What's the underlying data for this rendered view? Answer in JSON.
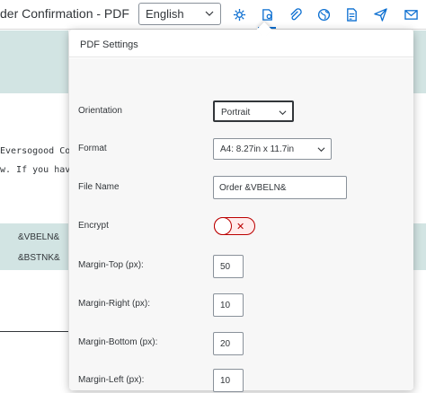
{
  "toolbar": {
    "doc_title": "der Confirmation - PDF",
    "language": "English",
    "icons": [
      "settings-icon",
      "pdf-settings-icon",
      "attachment-icon",
      "globe-icon",
      "document-icon",
      "send-icon",
      "email-icon"
    ]
  },
  "background": {
    "line1": "Eversogood Cor",
    "line2": "w. If you have a",
    "cell1": "&VBELN&",
    "cell2": "&BSTNK&"
  },
  "popover": {
    "title": "PDF Settings",
    "orientation_label": "Orientation",
    "orientation_value": "Portrait",
    "format_label": "Format",
    "format_value": "A4: 8.27in x 11.7in",
    "file_name_label": "File Name",
    "file_name_value": "Order &VBELN&",
    "encrypt_label": "Encrypt",
    "encrypt_on": false,
    "margin_top_label": "Margin-Top (px):",
    "margin_top_value": "50",
    "margin_right_label": "Margin-Right (px):",
    "margin_right_value": "10",
    "margin_bottom_label": "Margin-Bottom (px):",
    "margin_bottom_value": "20",
    "margin_left_label": "Margin-Left (px):",
    "margin_left_value": "10"
  },
  "colors": {
    "accent": "#0a6ed1",
    "teal_band": "#d2e4e3",
    "toggle_off": "#bb0000"
  }
}
